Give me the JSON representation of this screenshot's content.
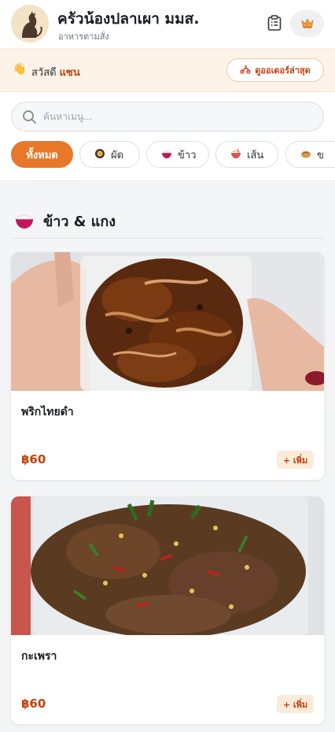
{
  "header": {
    "title": "ครัวน้องปลาเผา มมส.",
    "subtitle": "อาหารตามสั่ง",
    "orders_icon": "clipboard-icon",
    "premium_icon": "crown-icon"
  },
  "greeting": {
    "emoji": "👋",
    "text": "สวัสดี",
    "name": "แซน",
    "latest_order_label": "ดูออเดอร์ล่าสุด",
    "latest_order_icon": "scooter-icon"
  },
  "search": {
    "placeholder": "ค้นหาเมนู...",
    "value": ""
  },
  "categories": [
    {
      "label": "ทั้งหมด",
      "icon": "",
      "active": true
    },
    {
      "label": "ผัด",
      "icon": "pan-icon",
      "active": false
    },
    {
      "label": "ข้าว",
      "icon": "rice-icon",
      "active": false
    },
    {
      "label": "เส้น",
      "icon": "noodle-icon",
      "active": false
    },
    {
      "label": "ข",
      "icon": "dish-icon",
      "active": false
    }
  ],
  "section": {
    "title": "ข้าว & แกง",
    "icon": "rice-bowl-icon"
  },
  "menu_items": [
    {
      "name": "พริกไทยดำ",
      "price": "฿60",
      "add_label": "+ เพิ่ม"
    },
    {
      "name": "กะเพรา",
      "price": "฿60",
      "add_label": "+ เพิ่ม"
    }
  ],
  "colors": {
    "accent": "#e8772a",
    "price": "#c2410c",
    "greeting_bg": "#fdf3e8"
  }
}
